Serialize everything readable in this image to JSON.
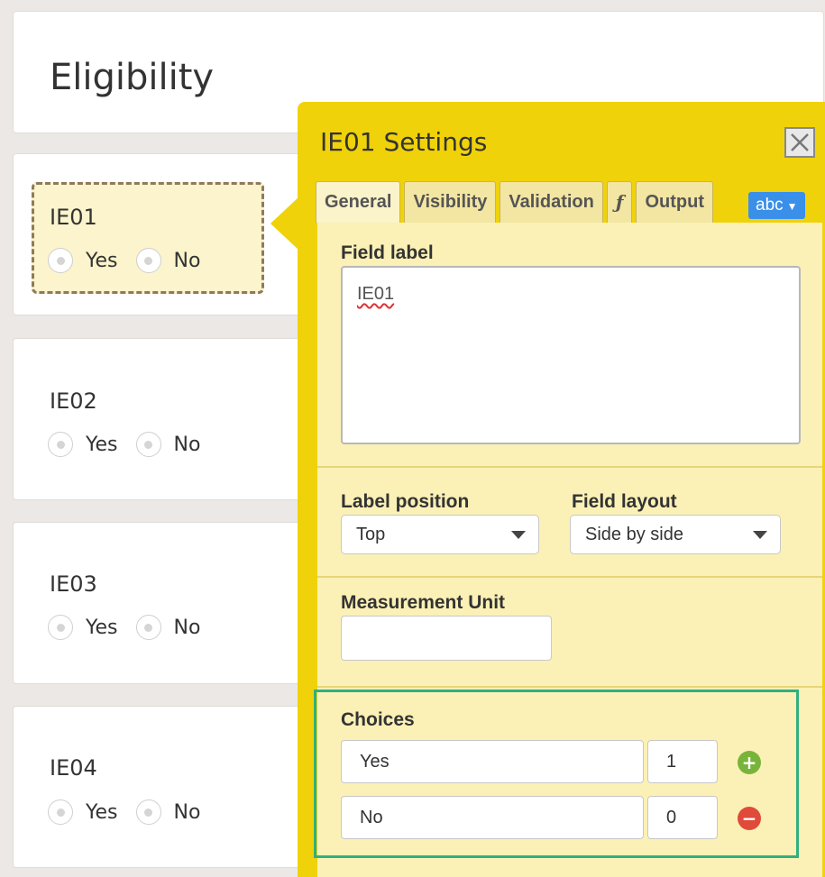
{
  "form": {
    "title": "Eligibility",
    "questions": [
      {
        "name": "IE01",
        "options": [
          "Yes",
          "No"
        ]
      },
      {
        "name": "IE02",
        "options": [
          "Yes",
          "No"
        ]
      },
      {
        "name": "IE03",
        "options": [
          "Yes",
          "No"
        ]
      },
      {
        "name": "IE04",
        "options": [
          "Yes",
          "No"
        ]
      }
    ]
  },
  "settings": {
    "title": "IE01 Settings",
    "close_icon": "close-icon",
    "tabs": [
      {
        "label": "General",
        "active": true
      },
      {
        "label": "Visibility"
      },
      {
        "label": "Validation"
      },
      {
        "label": "ƒ"
      },
      {
        "label": "Output"
      }
    ],
    "lang_button": "abc",
    "field_label": {
      "label": "Field label",
      "value": "IE01"
    },
    "label_position": {
      "label": "Label position",
      "value": "Top"
    },
    "field_layout": {
      "label": "Field layout",
      "value": "Side by side"
    },
    "measurement_unit": {
      "label": "Measurement Unit",
      "value": ""
    },
    "choices": {
      "label": "Choices",
      "rows": [
        {
          "text": "Yes",
          "value": "1",
          "action": "add"
        },
        {
          "text": "No",
          "value": "0",
          "action": "remove"
        }
      ]
    }
  },
  "colors": {
    "panel": "#f0d20a",
    "panel_body": "#fbf1b6",
    "highlight_box": "#2fb07e",
    "add_button": "#79b43a",
    "remove_button": "#e04a3a",
    "lang_button": "#3a8fe8"
  }
}
